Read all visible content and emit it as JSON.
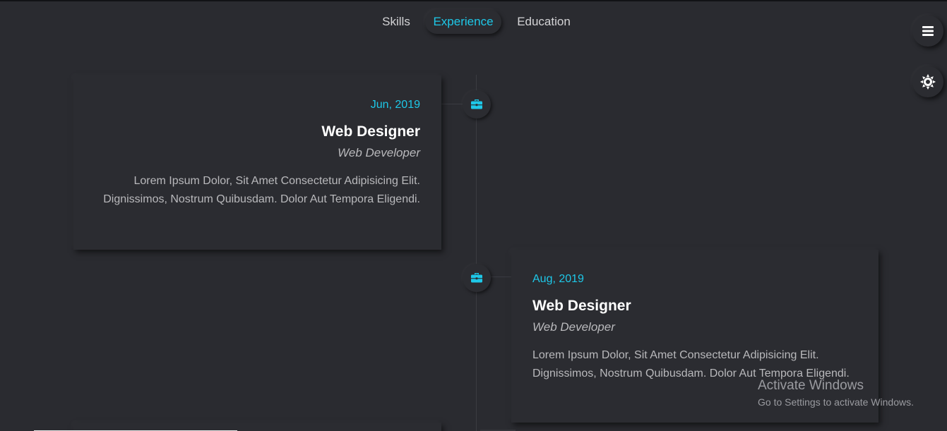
{
  "nav": {
    "tabs": [
      {
        "label": "Skills",
        "active": false
      },
      {
        "label": "Experience",
        "active": true
      },
      {
        "label": "Education",
        "active": false
      }
    ]
  },
  "accent_color": "#1ec8e8",
  "background_color": "#2a2b30",
  "buttons": {
    "menu_icon": "hamburger-menu-icon",
    "theme_icon": "sun-icon"
  },
  "timeline": {
    "items": [
      {
        "date": "Jun, 2019",
        "title": "Web Designer",
        "subtitle": "Web Developer",
        "description": "Lorem Ipsum Dolor, Sit Amet Consectetur Adipisicing Elit. Dignissimos, Nostrum Quibusdam. Dolor Aut Tempora Eligendi.",
        "icon": "briefcase-icon"
      },
      {
        "date": "Aug, 2019",
        "title": "Web Designer",
        "subtitle": "Web Developer",
        "description": "Lorem Ipsum Dolor, Sit Amet Consectetur Adipisicing Elit. Dignissimos, Nostrum Quibusdam. Dolor Aut Tempora Eligendi.",
        "icon": "briefcase-icon"
      }
    ]
  },
  "watermark": {
    "title": "Activate Windows",
    "subtitle": "Go to Settings to activate Windows."
  }
}
